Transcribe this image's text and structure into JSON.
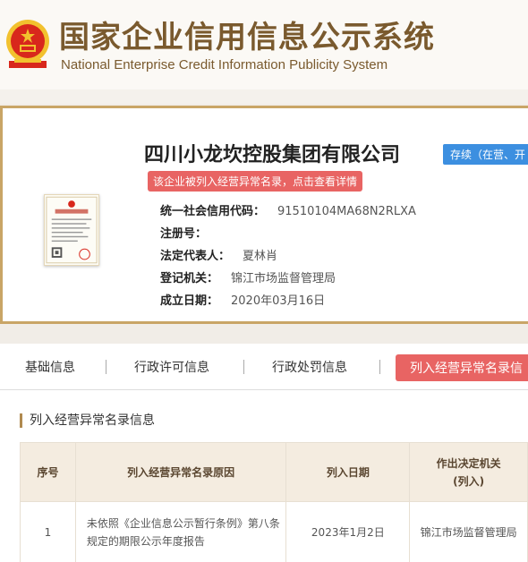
{
  "header": {
    "title_cn": "国家企业信用信息公示系统",
    "title_en": "National Enterprise Credit Information Publicity System",
    "colors": {
      "brand": "#7a5a2e",
      "emblem_red": "#d8271c",
      "emblem_gold": "#f2c12e"
    }
  },
  "company": {
    "name": "四川小龙坎控股集团有限公司",
    "status": "存续（在营、开",
    "abnormal_notice": "该企业被列入经营异常名录，点击查看详情",
    "fields": [
      {
        "label": "统一社会信用代码：",
        "value": "91510104MA68N2RLXA"
      },
      {
        "label": "注册号：",
        "value": ""
      },
      {
        "label": "法定代表人：",
        "value": "夏林肖"
      },
      {
        "label": "登记机关：",
        "value": "锦江市场监督管理局"
      },
      {
        "label": "成立日期：",
        "value": "2020年03月16日"
      }
    ],
    "license_title": "营业执照"
  },
  "tabs": [
    {
      "label": "基础信息"
    },
    {
      "label": "行政许可信息"
    },
    {
      "label": "行政处罚信息"
    },
    {
      "label": "列入经营异常名录信"
    }
  ],
  "section": {
    "title": "列入经营异常名录信息",
    "headers": [
      "序号",
      "列入经营异常名录原因",
      "列入日期",
      "作出决定机关\n(列入)"
    ],
    "rows": [
      {
        "index": "1",
        "reason": "未依照《企业信息公示暂行条例》第八条规定的期限公示年度报告",
        "date": "2023年1月2日",
        "authority": "锦江市场监督管理局"
      }
    ]
  },
  "colors": {
    "accent_red": "#e86463",
    "status_blue": "#3c8fe0",
    "border_gold": "#c9a566"
  }
}
